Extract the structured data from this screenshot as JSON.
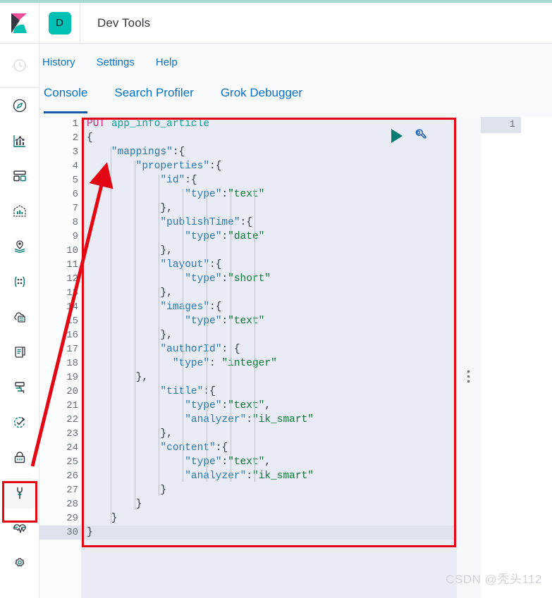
{
  "header": {
    "logo_icon": "kibana-logo",
    "space_badge": "D",
    "app_title": "Dev Tools"
  },
  "sidebar": {
    "recent_icon": "clock-icon",
    "items": [
      {
        "icon": "compass-discover-icon",
        "name": "discover",
        "selected": false
      },
      {
        "icon": "visualize-chart-icon",
        "name": "visualize",
        "selected": false
      },
      {
        "icon": "dashboard-grid-icon",
        "name": "dashboard",
        "selected": false
      },
      {
        "icon": "canvas-frame-icon",
        "name": "canvas",
        "selected": false
      },
      {
        "icon": "maps-pin-layers-icon",
        "name": "maps",
        "selected": false
      },
      {
        "icon": "machine-learning-icon",
        "name": "ml",
        "selected": false
      },
      {
        "icon": "infrastructure-icon",
        "name": "infra",
        "selected": false
      },
      {
        "icon": "logs-scroll-icon",
        "name": "logs",
        "selected": false
      },
      {
        "icon": "apm-icon",
        "name": "apm",
        "selected": false
      },
      {
        "icon": "uptime-check-icon",
        "name": "uptime",
        "selected": false
      },
      {
        "icon": "security-lock-icon",
        "name": "security",
        "selected": false
      },
      {
        "icon": "wrench-dev-tools-icon",
        "name": "dev-tools",
        "selected": true
      },
      {
        "icon": "monitoring-pulse-icon",
        "name": "monitoring",
        "selected": false
      },
      {
        "icon": "gear-management-icon",
        "name": "management",
        "selected": false
      }
    ]
  },
  "subnav": {
    "links": [
      {
        "label": "History"
      },
      {
        "label": "Settings"
      },
      {
        "label": "Help"
      }
    ]
  },
  "tabs": [
    {
      "label": "Console",
      "active": true
    },
    {
      "label": "Search Profiler",
      "active": false
    },
    {
      "label": "Grok Debugger",
      "active": false
    }
  ],
  "editor": {
    "play_icon": "play-send-request-icon",
    "wrench_icon": "wrench-actions-icon",
    "total_lines": 30,
    "current_line": 30,
    "fold_lines": [
      2,
      3,
      4,
      5,
      7,
      8,
      10,
      11,
      13,
      14,
      16,
      17,
      19,
      20,
      23,
      24,
      27,
      28,
      29,
      30
    ],
    "boxed_fold_line": 19,
    "lines": [
      {
        "n": 1,
        "tokens": [
          {
            "t": "PUT",
            "c": "tk-method"
          },
          {
            "t": " ",
            "c": ""
          },
          {
            "t": "app_info_article",
            "c": "tk-url"
          }
        ]
      },
      {
        "n": 2,
        "tokens": [
          {
            "t": "{",
            "c": "tk-punc"
          }
        ]
      },
      {
        "n": 3,
        "tokens": [
          {
            "t": "    ",
            "c": ""
          },
          {
            "t": "\"mappings\"",
            "c": "tk-key"
          },
          {
            "t": ":{",
            "c": "tk-punc"
          }
        ]
      },
      {
        "n": 4,
        "tokens": [
          {
            "t": "        ",
            "c": ""
          },
          {
            "t": "\"properties\"",
            "c": "tk-key"
          },
          {
            "t": ":{",
            "c": "tk-punc"
          }
        ]
      },
      {
        "n": 5,
        "tokens": [
          {
            "t": "            ",
            "c": ""
          },
          {
            "t": "\"id\"",
            "c": "tk-key"
          },
          {
            "t": ":{",
            "c": "tk-punc"
          }
        ]
      },
      {
        "n": 6,
        "tokens": [
          {
            "t": "                ",
            "c": ""
          },
          {
            "t": "\"type\"",
            "c": "tk-key"
          },
          {
            "t": ":",
            "c": "tk-punc"
          },
          {
            "t": "\"text\"",
            "c": "tk-str"
          }
        ]
      },
      {
        "n": 7,
        "tokens": [
          {
            "t": "            },",
            "c": "tk-punc"
          }
        ]
      },
      {
        "n": 8,
        "tokens": [
          {
            "t": "            ",
            "c": ""
          },
          {
            "t": "\"publishTime\"",
            "c": "tk-key"
          },
          {
            "t": ":{",
            "c": "tk-punc"
          }
        ]
      },
      {
        "n": 9,
        "tokens": [
          {
            "t": "                ",
            "c": ""
          },
          {
            "t": "\"type\"",
            "c": "tk-key"
          },
          {
            "t": ":",
            "c": "tk-punc"
          },
          {
            "t": "\"date\"",
            "c": "tk-str"
          }
        ]
      },
      {
        "n": 10,
        "tokens": [
          {
            "t": "            },",
            "c": "tk-punc"
          }
        ]
      },
      {
        "n": 11,
        "tokens": [
          {
            "t": "            ",
            "c": ""
          },
          {
            "t": "\"layout\"",
            "c": "tk-key"
          },
          {
            "t": ":{",
            "c": "tk-punc"
          }
        ]
      },
      {
        "n": 12,
        "tokens": [
          {
            "t": "                ",
            "c": ""
          },
          {
            "t": "\"type\"",
            "c": "tk-key"
          },
          {
            "t": ":",
            "c": "tk-punc"
          },
          {
            "t": "\"short\"",
            "c": "tk-str"
          }
        ]
      },
      {
        "n": 13,
        "tokens": [
          {
            "t": "            },",
            "c": "tk-punc"
          }
        ]
      },
      {
        "n": 14,
        "tokens": [
          {
            "t": "            ",
            "c": ""
          },
          {
            "t": "\"images\"",
            "c": "tk-key"
          },
          {
            "t": ":{",
            "c": "tk-punc"
          }
        ]
      },
      {
        "n": 15,
        "tokens": [
          {
            "t": "                ",
            "c": ""
          },
          {
            "t": "\"type\"",
            "c": "tk-key"
          },
          {
            "t": ":",
            "c": "tk-punc"
          },
          {
            "t": "\"text\"",
            "c": "tk-str"
          }
        ]
      },
      {
        "n": 16,
        "tokens": [
          {
            "t": "            },",
            "c": "tk-punc"
          }
        ]
      },
      {
        "n": 17,
        "tokens": [
          {
            "t": "            ",
            "c": ""
          },
          {
            "t": "\"authorId\"",
            "c": "tk-key"
          },
          {
            "t": ": {",
            "c": "tk-punc"
          }
        ]
      },
      {
        "n": 18,
        "tokens": [
          {
            "t": "              ",
            "c": ""
          },
          {
            "t": "\"type\"",
            "c": "tk-key"
          },
          {
            "t": ": ",
            "c": "tk-punc"
          },
          {
            "t": "\"integer\"",
            "c": "tk-str"
          }
        ]
      },
      {
        "n": 19,
        "tokens": [
          {
            "t": "        },",
            "c": "tk-punc"
          }
        ]
      },
      {
        "n": 20,
        "tokens": [
          {
            "t": "            ",
            "c": ""
          },
          {
            "t": "\"title\"",
            "c": "tk-key"
          },
          {
            "t": ":{",
            "c": "tk-punc"
          }
        ]
      },
      {
        "n": 21,
        "tokens": [
          {
            "t": "                ",
            "c": ""
          },
          {
            "t": "\"type\"",
            "c": "tk-key"
          },
          {
            "t": ":",
            "c": "tk-punc"
          },
          {
            "t": "\"text\"",
            "c": "tk-str"
          },
          {
            "t": ",",
            "c": "tk-punc"
          }
        ]
      },
      {
        "n": 22,
        "tokens": [
          {
            "t": "                ",
            "c": ""
          },
          {
            "t": "\"analyzer\"",
            "c": "tk-key"
          },
          {
            "t": ":",
            "c": "tk-punc"
          },
          {
            "t": "\"ik_smart\"",
            "c": "tk-str"
          }
        ]
      },
      {
        "n": 23,
        "tokens": [
          {
            "t": "            },",
            "c": "tk-punc"
          }
        ]
      },
      {
        "n": 24,
        "tokens": [
          {
            "t": "            ",
            "c": ""
          },
          {
            "t": "\"content\"",
            "c": "tk-key"
          },
          {
            "t": ":{",
            "c": "tk-punc"
          }
        ]
      },
      {
        "n": 25,
        "tokens": [
          {
            "t": "                ",
            "c": ""
          },
          {
            "t": "\"type\"",
            "c": "tk-key"
          },
          {
            "t": ":",
            "c": "tk-punc"
          },
          {
            "t": "\"text\"",
            "c": "tk-str"
          },
          {
            "t": ",",
            "c": "tk-punc"
          }
        ]
      },
      {
        "n": 26,
        "tokens": [
          {
            "t": "                ",
            "c": ""
          },
          {
            "t": "\"analyzer\"",
            "c": "tk-key"
          },
          {
            "t": ":",
            "c": "tk-punc"
          },
          {
            "t": "\"ik_smart\"",
            "c": "tk-str"
          }
        ]
      },
      {
        "n": 27,
        "tokens": [
          {
            "t": "            }",
            "c": "tk-punc"
          }
        ]
      },
      {
        "n": 28,
        "tokens": [
          {
            "t": "        }",
            "c": "tk-punc"
          }
        ]
      },
      {
        "n": 29,
        "tokens": [
          {
            "t": "    }",
            "c": "tk-punc"
          }
        ]
      },
      {
        "n": 30,
        "tokens": [
          {
            "t": "}",
            "c": "tk-punc"
          }
        ]
      }
    ]
  },
  "output": {
    "line_number": "1",
    "drag_handle_icon": "drag-handle-dots-icon"
  },
  "watermark": {
    "text": "CSDN @秃头112"
  },
  "annotations": {
    "editor_box_color": "#e30613",
    "rail_box_color": "#e30613",
    "arrow_color": "#e30613"
  },
  "colors": {
    "accent_teal": "#00bfb3",
    "link_blue": "#0671c4",
    "tab_active_underline": "#1558a8",
    "editor_bg": "#e9ebf5",
    "current_line_bg": "#dfe3ed"
  }
}
